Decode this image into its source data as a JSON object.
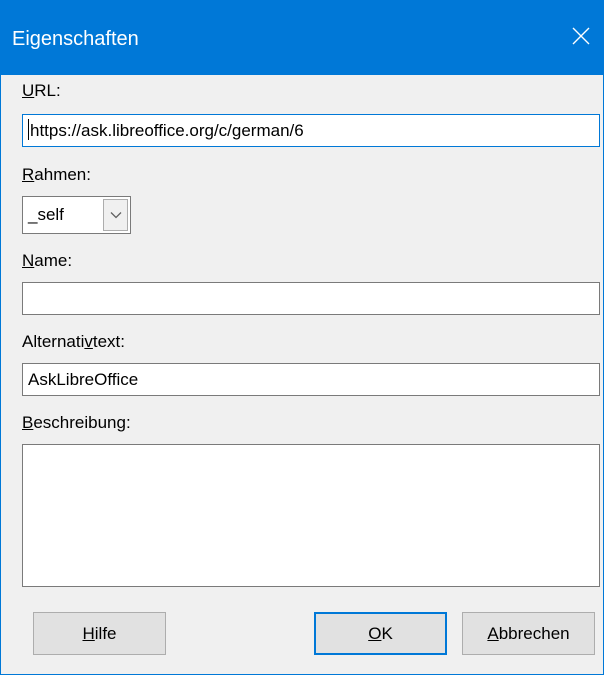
{
  "window": {
    "title": "Eigenschaften",
    "close_icon": "close-icon",
    "accent_color": "#0078d7"
  },
  "url": {
    "label_mnemonic": "U",
    "label_rest": "RL:",
    "value": "https://ask.libreoffice.org/c/german/6"
  },
  "frame": {
    "label_mnemonic": "R",
    "label_rest": "ahmen:",
    "selected": "_self",
    "arrow_icon": "chevron-down-icon"
  },
  "name": {
    "label_mnemonic": "N",
    "label_rest": "ame:",
    "value": ""
  },
  "alt_text": {
    "label_before": "Alternati",
    "label_mnemonic": "v",
    "label_after": "text:",
    "value": "AskLibreOffice"
  },
  "description": {
    "label_mnemonic": "B",
    "label_rest": "eschreibung:",
    "value": ""
  },
  "buttons": {
    "help_mnemonic": "H",
    "help_rest": "ilfe",
    "ok_mnemonic": "O",
    "ok_rest": "K",
    "cancel_mnemonic": "A",
    "cancel_rest": "bbrechen"
  }
}
